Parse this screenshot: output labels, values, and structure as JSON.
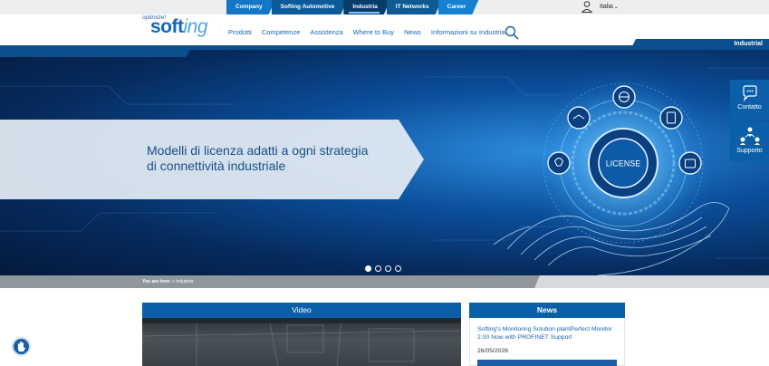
{
  "topbar": {
    "tabs": [
      {
        "label": "Company"
      },
      {
        "label": "Softing Automotive"
      },
      {
        "label": "Industria"
      },
      {
        "label": "IT Networks"
      },
      {
        "label": "Career"
      }
    ],
    "language": "Italia"
  },
  "header": {
    "logo_tagline": "optimize!",
    "logo_soft": "soft",
    "logo_ing": "ing",
    "nav": [
      {
        "label": "Prodotti"
      },
      {
        "label": "Competenze"
      },
      {
        "label": "Assistenza"
      },
      {
        "label": "Where to Buy"
      },
      {
        "label": "News"
      },
      {
        "label": "Informazioni su Industrial"
      }
    ],
    "section_label": "Industrial"
  },
  "hero": {
    "headline_line1": "Modelli di licenza adatti a ogni strategia",
    "headline_line2": "di connettività industriale",
    "badge_text": "LICENSE",
    "slides": 4,
    "active_slide": 1
  },
  "side_widgets": {
    "contact_label": "Contatto",
    "support_label": "Supporto"
  },
  "breadcrumb": {
    "prefix": "You are here:",
    "current": "Industria"
  },
  "video": {
    "heading": "Video"
  },
  "news": {
    "heading": "News",
    "item_title": "Softing's Monitoring Solution plantPerfect Monitor 2.00 Now with PROFINET Support",
    "item_date": "26/05/2026"
  },
  "colors": {
    "brand_blue": "#0b5fa8",
    "dark_blue": "#0b4f8f",
    "link_blue": "#1a64ad"
  }
}
